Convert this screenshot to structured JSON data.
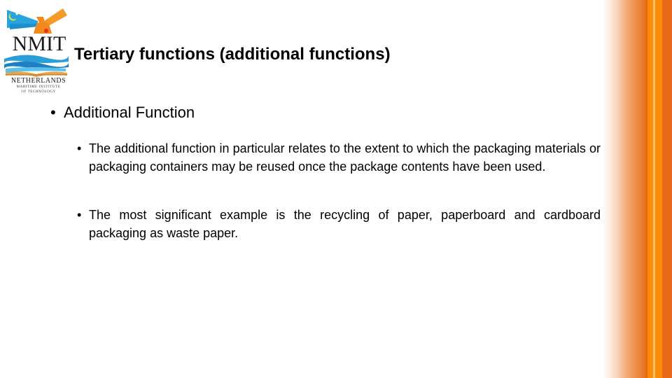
{
  "logo": {
    "name": "NMIT",
    "line1": "NETHERLANDS",
    "line2": "MARITIME INSTITUTE",
    "line3": "OF TECHNOLOGY"
  },
  "slide": {
    "title": "Tertiary functions (additional functions)",
    "bullet_char": "•",
    "level1": "Additional Function",
    "level2": [
      "The additional function in particular relates to the extent to which the packaging materials or packaging containers may be reused once the package contents have been used.",
      "The most significant example is the recycling of paper, paperboard and cardboard packaging as waste paper."
    ]
  },
  "colors": {
    "accent_orange": "#fb8c08",
    "accent_dark_orange": "#e9691a",
    "logo_blue": "#29a3dd"
  }
}
